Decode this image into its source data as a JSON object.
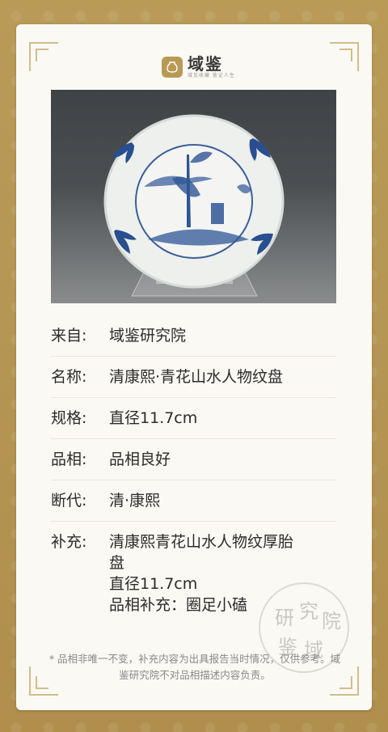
{
  "brand": {
    "name": "域鉴",
    "tagline": "域见收藏 鉴证人生"
  },
  "item": {
    "rows": [
      {
        "key": "来自:",
        "value": "域鉴研究院"
      },
      {
        "key": "名称:",
        "value": "清康熙·青花山水人物纹盘"
      },
      {
        "key": "规格:",
        "value": "直径11.7cm"
      },
      {
        "key": "品相:",
        "value": "品相良好"
      },
      {
        "key": "断代:",
        "value": "清·康熙"
      },
      {
        "key": "补充:",
        "value": "清康熙青花山水人物纹厚胎\n盘\n直径11.7cm\n品相补充：圈足小磕"
      }
    ]
  },
  "stamp": {
    "chars": [
      "研",
      "究",
      "院",
      "鉴",
      "域"
    ]
  },
  "footnote": "* 品相非唯一不变，补充内容为出具报告当时情况，仅供参考。域鉴研究院不对品相描述内容负责。",
  "colors": {
    "gold": "#b89a55",
    "card": "#fbf9f4",
    "blue": "#2a4f8f"
  }
}
